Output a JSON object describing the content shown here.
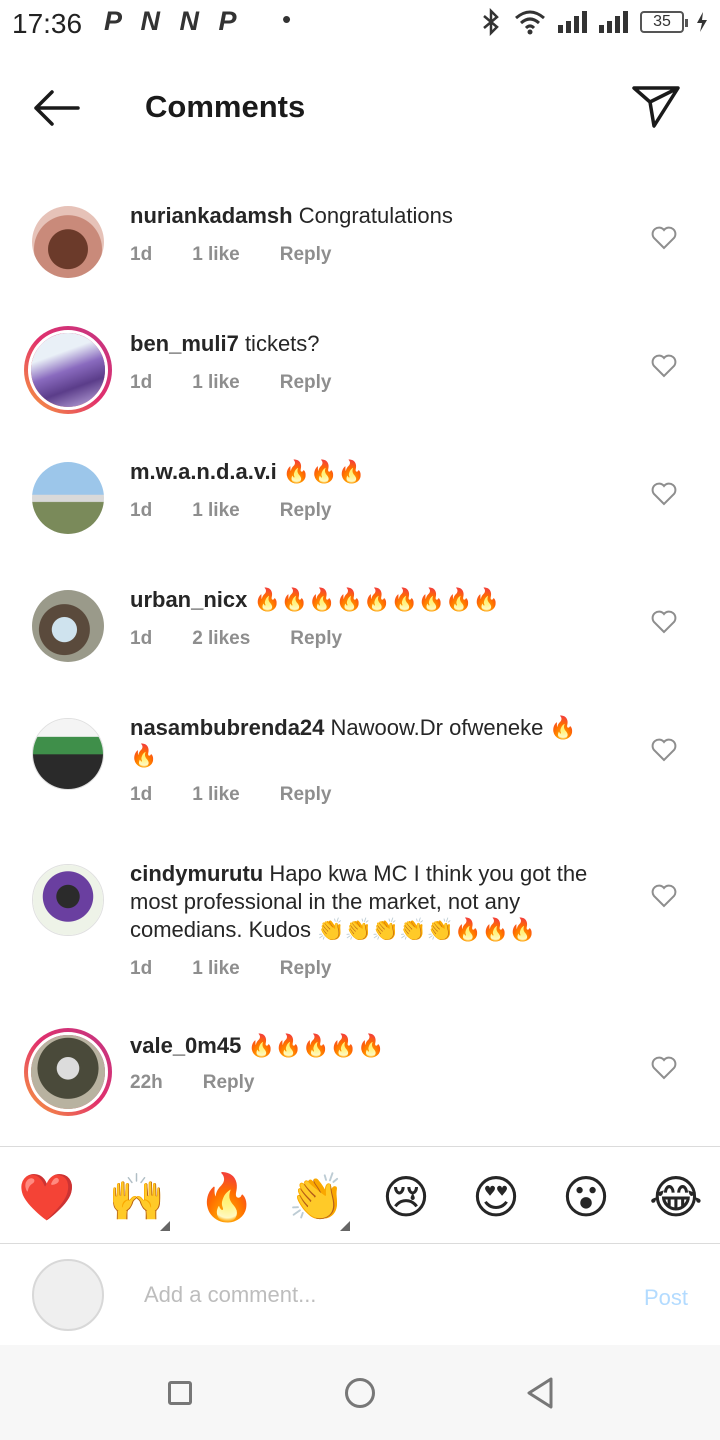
{
  "status_bar": {
    "time": "17:36",
    "app_icons": "P N N P",
    "dot": "•",
    "battery": "35",
    "icons": [
      "bluetooth-icon",
      "wifi-icon",
      "signal-icon",
      "signal-icon",
      "battery-icon",
      "charging-icon"
    ]
  },
  "header": {
    "title": "Comments",
    "back_icon": "arrow-left-icon",
    "share_icon": "paper-plane-icon"
  },
  "comments": [
    {
      "user": "nuriankadamsh",
      "text": "Congratulations",
      "time": "1d",
      "likes": "1 like",
      "reply": "Reply"
    },
    {
      "user": "ben_muli7",
      "text": "tickets?",
      "time": "1d",
      "likes": "1 like",
      "reply": "Reply"
    },
    {
      "user": "m.w.a.n.d.a.v.i",
      "text": "🔥🔥🔥",
      "time": "1d",
      "likes": "1 like",
      "reply": "Reply"
    },
    {
      "user": "urban_nicx",
      "text": "🔥🔥🔥🔥🔥🔥🔥🔥🔥",
      "time": "1d",
      "likes": "2 likes",
      "reply": "Reply"
    },
    {
      "user": "nasambubrenda24",
      "text": "Nawoow.Dr ofweneke 🔥🔥",
      "time": "1d",
      "likes": "1 like",
      "reply": "Reply"
    },
    {
      "user": "cindymurutu",
      "text": "Hapo kwa MC I think you got the most professional in the market, not any comedians. Kudos 👏👏👏👏👏🔥🔥🔥",
      "time": "1d",
      "likes": "1 like",
      "reply": "Reply"
    },
    {
      "user": "vale_0m45",
      "text": "🔥🔥🔥🔥🔥",
      "time": "22h",
      "likes": "",
      "reply": "Reply"
    }
  ],
  "reactions": [
    "❤️",
    "🙌",
    "🔥",
    "👏",
    "😢",
    "😍",
    "😮",
    "😂"
  ],
  "composer": {
    "placeholder": "Add a comment...",
    "post_label": "Post"
  },
  "colors": {
    "story_ring_start": "#f9a23c",
    "story_ring_end": "#c13584",
    "post_disabled": "#b3dbff",
    "meta_gray": "#8e8e8e"
  }
}
